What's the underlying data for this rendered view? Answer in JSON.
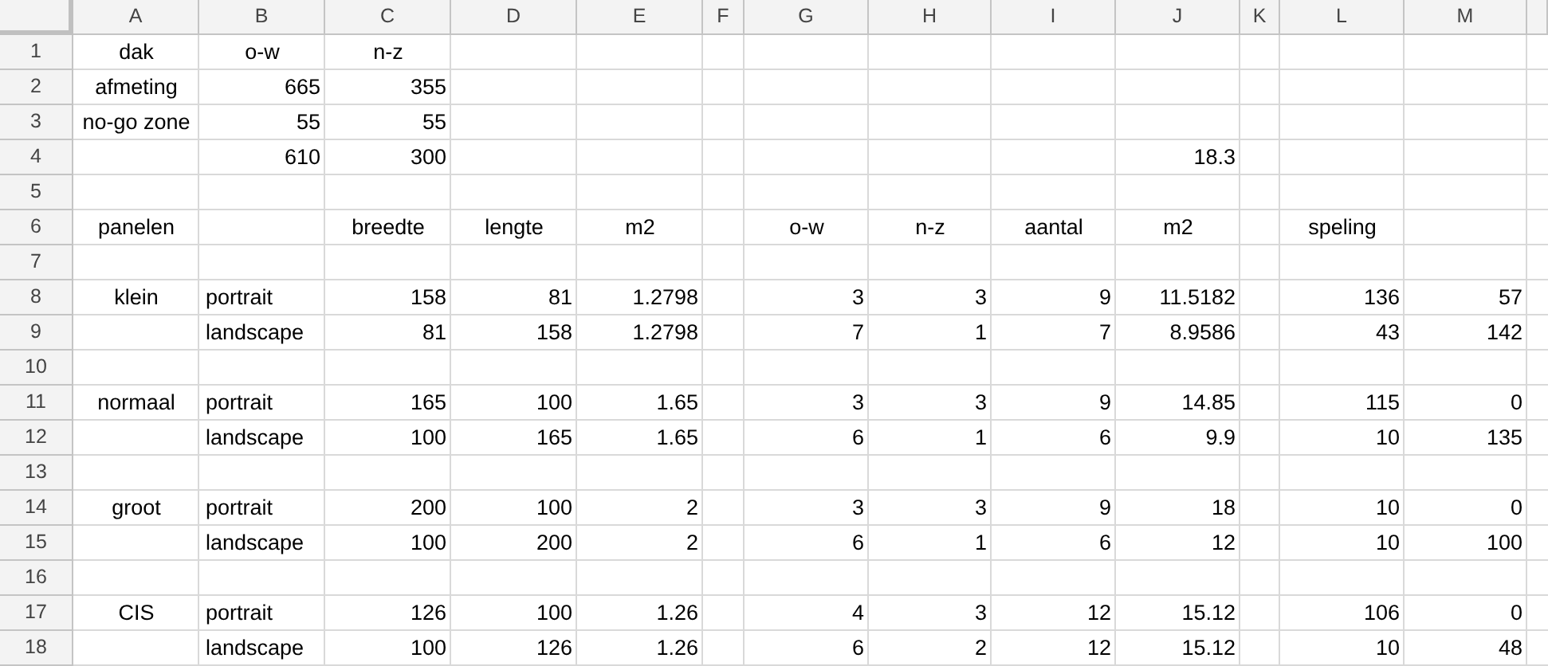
{
  "column_headers": [
    "A",
    "B",
    "C",
    "D",
    "E",
    "F",
    "G",
    "H",
    "I",
    "J",
    "K",
    "L",
    "M"
  ],
  "rows": [
    {
      "number": "1",
      "cells": {
        "a": {
          "text": "dak",
          "kind": "heading"
        },
        "b": {
          "text": "o-w",
          "kind": "heading"
        },
        "c": {
          "text": "n-z",
          "kind": "heading"
        }
      }
    },
    {
      "number": "2",
      "cells": {
        "a": {
          "text": "afmeting",
          "kind": "heading"
        },
        "b": {
          "text": "665",
          "kind": "number"
        },
        "c": {
          "text": "355",
          "kind": "number"
        }
      }
    },
    {
      "number": "3",
      "cells": {
        "a": {
          "text": "no-go zone",
          "kind": "heading"
        },
        "b": {
          "text": "55",
          "kind": "number"
        },
        "c": {
          "text": "55",
          "kind": "number"
        }
      }
    },
    {
      "number": "4",
      "cells": {
        "b": {
          "text": "610",
          "kind": "number"
        },
        "c": {
          "text": "300",
          "kind": "number"
        },
        "j": {
          "text": "18.3",
          "kind": "number"
        }
      }
    },
    {
      "number": "5",
      "cells": {}
    },
    {
      "number": "6",
      "cells": {
        "a": {
          "text": "panelen",
          "kind": "heading"
        },
        "c": {
          "text": "breedte",
          "kind": "heading"
        },
        "d": {
          "text": "lengte",
          "kind": "heading"
        },
        "e": {
          "text": "m2",
          "kind": "heading"
        },
        "g": {
          "text": "o-w",
          "kind": "heading"
        },
        "h": {
          "text": "n-z",
          "kind": "heading"
        },
        "i": {
          "text": "aantal",
          "kind": "heading"
        },
        "j": {
          "text": "m2",
          "kind": "heading"
        },
        "l": {
          "text": "speling",
          "kind": "heading"
        }
      }
    },
    {
      "number": "7",
      "cells": {}
    },
    {
      "number": "8",
      "cells": {
        "a": {
          "text": "klein",
          "kind": "heading"
        },
        "b": {
          "text": "portrait",
          "kind": "text"
        },
        "c": {
          "text": "158",
          "kind": "number"
        },
        "d": {
          "text": "81",
          "kind": "number"
        },
        "e": {
          "text": "1.2798",
          "kind": "number"
        },
        "g": {
          "text": "3",
          "kind": "number"
        },
        "h": {
          "text": "3",
          "kind": "number"
        },
        "i": {
          "text": "9",
          "kind": "number"
        },
        "j": {
          "text": "11.5182",
          "kind": "number"
        },
        "l": {
          "text": "136",
          "kind": "number"
        },
        "m": {
          "text": "57",
          "kind": "number"
        }
      }
    },
    {
      "number": "9",
      "cells": {
        "b": {
          "text": "landscape",
          "kind": "text"
        },
        "c": {
          "text": "81",
          "kind": "number"
        },
        "d": {
          "text": "158",
          "kind": "number"
        },
        "e": {
          "text": "1.2798",
          "kind": "number"
        },
        "g": {
          "text": "7",
          "kind": "number"
        },
        "h": {
          "text": "1",
          "kind": "number"
        },
        "i": {
          "text": "7",
          "kind": "number"
        },
        "j": {
          "text": "8.9586",
          "kind": "number"
        },
        "l": {
          "text": "43",
          "kind": "number"
        },
        "m": {
          "text": "142",
          "kind": "number"
        }
      }
    },
    {
      "number": "10",
      "cells": {}
    },
    {
      "number": "11",
      "cells": {
        "a": {
          "text": "normaal",
          "kind": "heading"
        },
        "b": {
          "text": "portrait",
          "kind": "text"
        },
        "c": {
          "text": "165",
          "kind": "number"
        },
        "d": {
          "text": "100",
          "kind": "number"
        },
        "e": {
          "text": "1.65",
          "kind": "number"
        },
        "g": {
          "text": "3",
          "kind": "number"
        },
        "h": {
          "text": "3",
          "kind": "number"
        },
        "i": {
          "text": "9",
          "kind": "number"
        },
        "j": {
          "text": "14.85",
          "kind": "number"
        },
        "l": {
          "text": "115",
          "kind": "number"
        },
        "m": {
          "text": "0",
          "kind": "number"
        }
      }
    },
    {
      "number": "12",
      "cells": {
        "b": {
          "text": "landscape",
          "kind": "text"
        },
        "c": {
          "text": "100",
          "kind": "number"
        },
        "d": {
          "text": "165",
          "kind": "number"
        },
        "e": {
          "text": "1.65",
          "kind": "number"
        },
        "g": {
          "text": "6",
          "kind": "number"
        },
        "h": {
          "text": "1",
          "kind": "number"
        },
        "i": {
          "text": "6",
          "kind": "number"
        },
        "j": {
          "text": "9.9",
          "kind": "number"
        },
        "l": {
          "text": "10",
          "kind": "number"
        },
        "m": {
          "text": "135",
          "kind": "number"
        }
      }
    },
    {
      "number": "13",
      "cells": {}
    },
    {
      "number": "14",
      "cells": {
        "a": {
          "text": "groot",
          "kind": "heading"
        },
        "b": {
          "text": "portrait",
          "kind": "text"
        },
        "c": {
          "text": "200",
          "kind": "number"
        },
        "d": {
          "text": "100",
          "kind": "number"
        },
        "e": {
          "text": "2",
          "kind": "number"
        },
        "g": {
          "text": "3",
          "kind": "number"
        },
        "h": {
          "text": "3",
          "kind": "number"
        },
        "i": {
          "text": "9",
          "kind": "number"
        },
        "j": {
          "text": "18",
          "kind": "number"
        },
        "l": {
          "text": "10",
          "kind": "number"
        },
        "m": {
          "text": "0",
          "kind": "number"
        }
      }
    },
    {
      "number": "15",
      "cells": {
        "b": {
          "text": "landscape",
          "kind": "text"
        },
        "c": {
          "text": "100",
          "kind": "number"
        },
        "d": {
          "text": "200",
          "kind": "number"
        },
        "e": {
          "text": "2",
          "kind": "number"
        },
        "g": {
          "text": "6",
          "kind": "number"
        },
        "h": {
          "text": "1",
          "kind": "number"
        },
        "i": {
          "text": "6",
          "kind": "number"
        },
        "j": {
          "text": "12",
          "kind": "number"
        },
        "l": {
          "text": "10",
          "kind": "number"
        },
        "m": {
          "text": "100",
          "kind": "number"
        }
      }
    },
    {
      "number": "16",
      "cells": {}
    },
    {
      "number": "17",
      "cells": {
        "a": {
          "text": "CIS",
          "kind": "heading"
        },
        "b": {
          "text": "portrait",
          "kind": "text"
        },
        "c": {
          "text": "126",
          "kind": "number"
        },
        "d": {
          "text": "100",
          "kind": "number"
        },
        "e": {
          "text": "1.26",
          "kind": "number"
        },
        "g": {
          "text": "4",
          "kind": "number"
        },
        "h": {
          "text": "3",
          "kind": "number"
        },
        "i": {
          "text": "12",
          "kind": "number"
        },
        "j": {
          "text": "15.12",
          "kind": "number"
        },
        "l": {
          "text": "106",
          "kind": "number"
        },
        "m": {
          "text": "0",
          "kind": "number"
        }
      }
    },
    {
      "number": "18",
      "cells": {
        "b": {
          "text": "landscape",
          "kind": "text"
        },
        "c": {
          "text": "100",
          "kind": "number"
        },
        "d": {
          "text": "126",
          "kind": "number"
        },
        "e": {
          "text": "1.26",
          "kind": "number"
        },
        "g": {
          "text": "6",
          "kind": "number"
        },
        "h": {
          "text": "2",
          "kind": "number"
        },
        "i": {
          "text": "12",
          "kind": "number"
        },
        "j": {
          "text": "15.12",
          "kind": "number"
        },
        "l": {
          "text": "10",
          "kind": "number"
        },
        "m": {
          "text": "48",
          "kind": "number"
        }
      }
    }
  ]
}
